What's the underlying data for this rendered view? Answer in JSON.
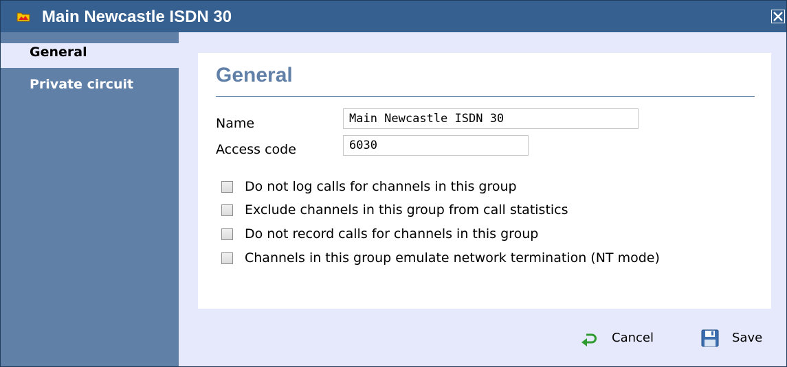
{
  "dialog": {
    "title": "Main Newcastle ISDN 30",
    "title_icon": "folder-icon",
    "close_icon": "close-icon"
  },
  "sidebar": {
    "items": [
      {
        "label": "General",
        "active": true
      },
      {
        "label": "Private circuit",
        "active": false
      }
    ]
  },
  "main": {
    "section_title": "General",
    "fields": {
      "name": {
        "label": "Name",
        "value": "Main Newcastle ISDN 30"
      },
      "access_code": {
        "label": "Access code",
        "value": "6030"
      }
    },
    "checkboxes": [
      {
        "label": "Do not log calls for channels in this group",
        "checked": false
      },
      {
        "label": "Exclude channels in this group from call statistics",
        "checked": false
      },
      {
        "label": "Do not record calls for channels in this group",
        "checked": false
      },
      {
        "label": "Channels in this group emulate network termination (NT mode)",
        "checked": false
      }
    ]
  },
  "footer": {
    "cancel_label": "Cancel",
    "cancel_icon": "undo-arrow-icon",
    "save_label": "Save",
    "save_icon": "floppy-disk-icon"
  },
  "colors": {
    "titlebar": "#35608f",
    "sidebar": "#6180a8",
    "dialog_bg": "#e6e8fb",
    "accent_text": "#6180a8"
  }
}
